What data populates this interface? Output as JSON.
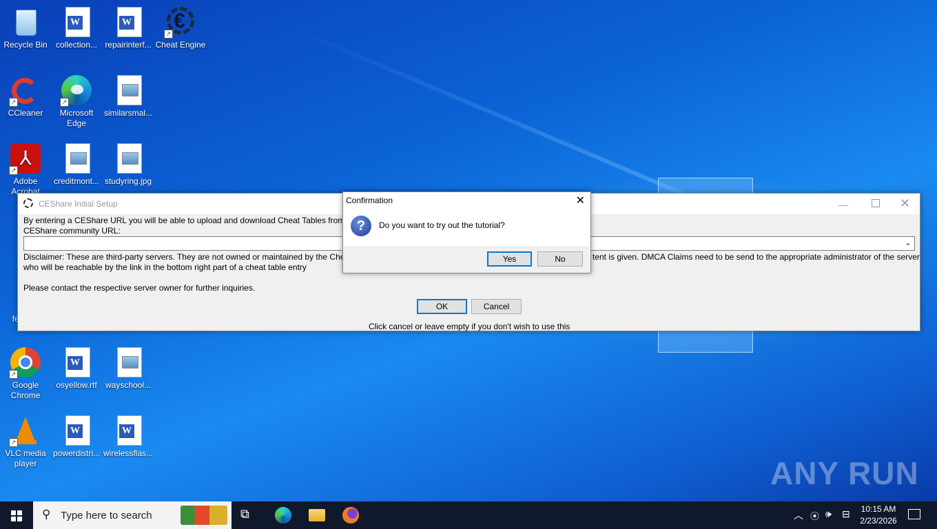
{
  "desktop_icons": [
    {
      "label": "Recycle Bin",
      "icon": "recycle-bin-icon"
    },
    {
      "label": "collection...",
      "icon": "word-doc-icon"
    },
    {
      "label": "repairinterf...",
      "icon": "word-doc-icon"
    },
    {
      "label": "Cheat Engine",
      "icon": "cheat-engine-icon"
    },
    {
      "label": "CCleaner",
      "icon": "ccleaner-icon"
    },
    {
      "label": "Microsoft Edge",
      "icon": "edge-icon"
    },
    {
      "label": "similarsmal...",
      "icon": "image-file-icon"
    },
    {
      "label": "Adobe Acrobat",
      "icon": "acrobat-icon"
    },
    {
      "label": "creditmont...",
      "icon": "image-file-icon"
    },
    {
      "label": "studyring.jpg",
      "icon": "image-file-icon"
    },
    {
      "label": "F",
      "icon": "firefox-icon"
    },
    {
      "label": "few",
      "icon": "word-doc-icon"
    },
    {
      "label": "Google Chrome",
      "icon": "chrome-icon"
    },
    {
      "label": "osyellow.rtf",
      "icon": "word-doc-icon"
    },
    {
      "label": "wayschool...",
      "icon": "image-file-icon"
    },
    {
      "label": "VLC media player",
      "icon": "vlc-icon"
    },
    {
      "label": "powerdistri...",
      "icon": "word-doc-icon"
    },
    {
      "label": "wirelessflas...",
      "icon": "word-doc-icon"
    }
  ],
  "ceshare": {
    "title": "CEShare Initial Setup",
    "intro": "By entering a CEShare URL you will be able to upload and download Cheat Tables from a",
    "url_label": "CEShare community URL:",
    "url_value": "",
    "disclaimer_left": "Disclaimer: These are third-party servers. They are not owned or maintained by the Cheat",
    "disclaimer_right": "tent is given.  DMCA Claims need to be send to the appropriate administrator of the server",
    "disclaimer_line2": "who will be reachable by the link in the bottom right part of a cheat table entry",
    "contact": "Please contact the respective server owner for further inquiries.",
    "ok": "OK",
    "cancel": "Cancel",
    "footer": "Click cancel or leave empty if you don't wish to use this"
  },
  "confirm": {
    "title": "Confirmation",
    "message": "Do you want to try out the tutorial?",
    "yes": "Yes",
    "no": "No"
  },
  "taskbar": {
    "search_placeholder": "Type here to search",
    "time": "10:15 AM",
    "date": "2/23/2026"
  },
  "watermark": "ANY RUN"
}
